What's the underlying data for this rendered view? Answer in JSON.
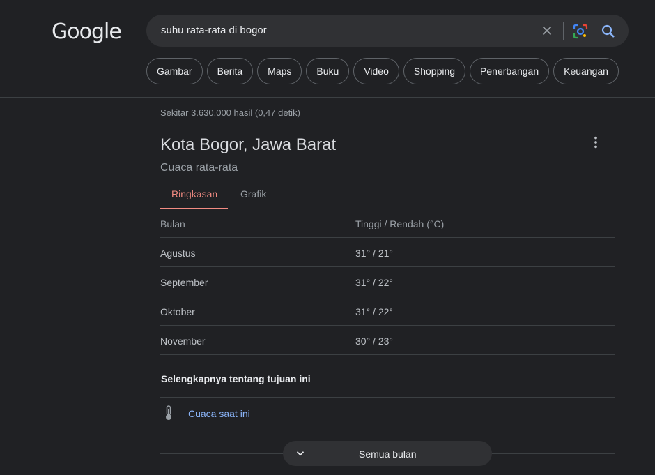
{
  "logo": "Google",
  "search": {
    "query": "suhu rata-rata di bogor"
  },
  "chips": [
    "Gambar",
    "Berita",
    "Maps",
    "Buku",
    "Video",
    "Shopping",
    "Penerbangan",
    "Keuangan"
  ],
  "result_stats": "Sekitar 3.630.000 hasil (0,47 detik)",
  "card": {
    "title": "Kota Bogor, Jawa Barat",
    "subtitle": "Cuaca rata-rata",
    "tabs": [
      "Ringkasan",
      "Grafik"
    ],
    "table": {
      "headers": [
        "Bulan",
        "Tinggi / Rendah (°C)"
      ],
      "rows": [
        [
          "Agustus",
          "31° / 21°"
        ],
        [
          "September",
          "31° / 22°"
        ],
        [
          "Oktober",
          "31° / 22°"
        ],
        [
          "November",
          "30° / 23°"
        ]
      ]
    },
    "more_heading": "Selengkapnya tentang tujuan ini",
    "current_weather_link": "Cuaca saat ini",
    "all_months_button": "Semua bulan"
  },
  "colors": {
    "background": "#202124",
    "accent_tab": "#f28b82",
    "link": "#8ab4f8"
  },
  "icons": [
    "clear-icon",
    "google-lens-icon",
    "search-icon",
    "more-vert-icon",
    "thermometer-icon",
    "chevron-down-icon"
  ]
}
